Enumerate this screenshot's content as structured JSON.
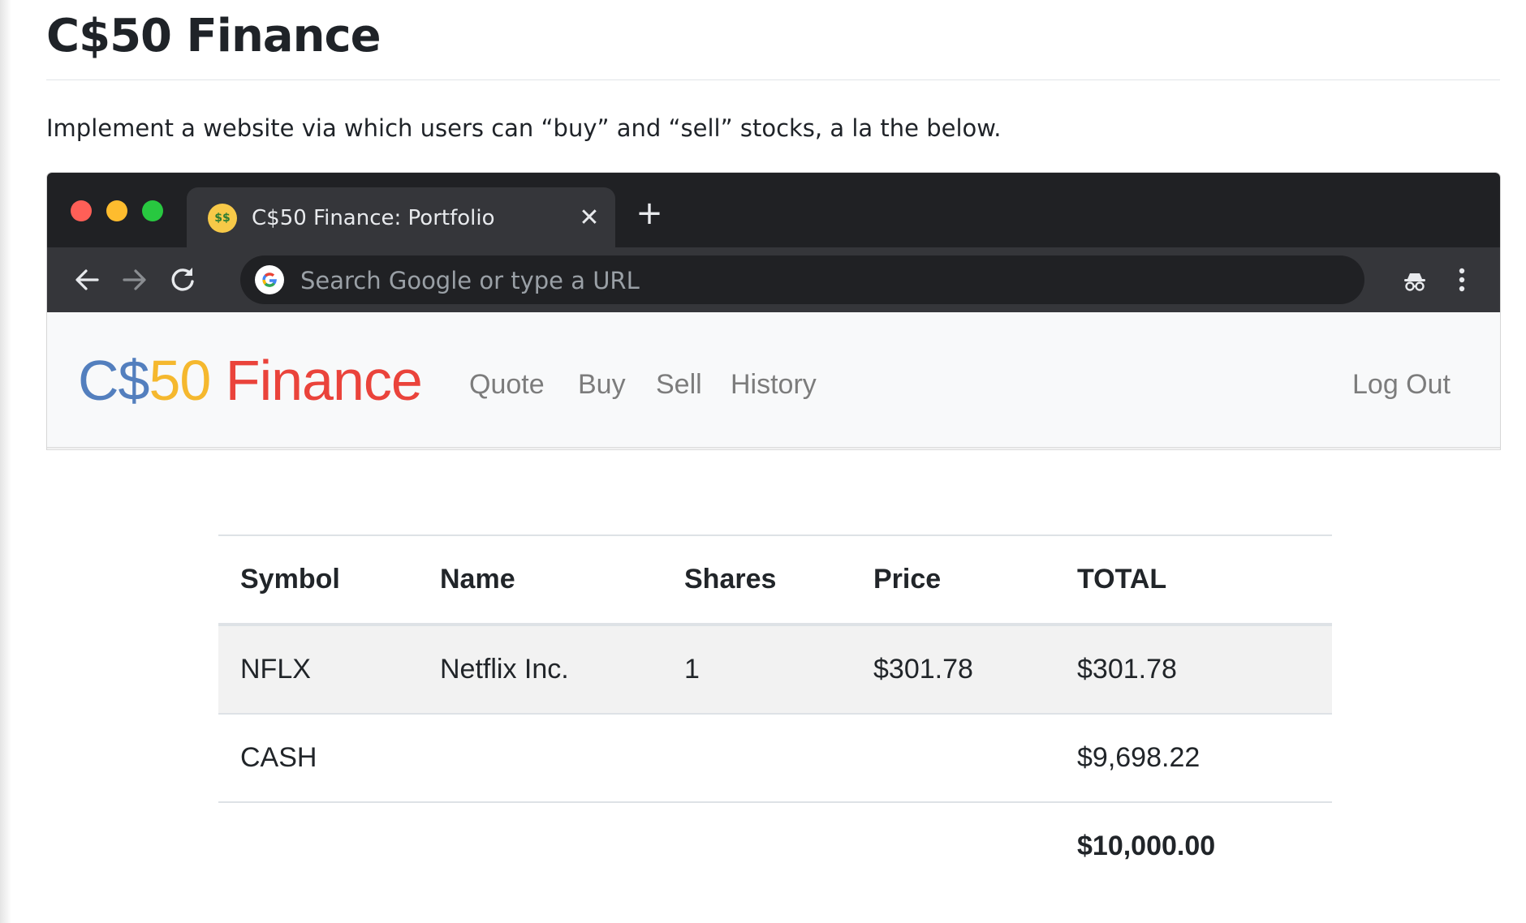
{
  "doc": {
    "title": "C$50 Finance",
    "intro": "Implement a website via which users can “buy” and “sell” stocks, a la the below."
  },
  "browser": {
    "tab": {
      "title": "C$50 Finance: Portfolio",
      "favicon": "money-mouth-face-icon",
      "close": "✕"
    },
    "new_tab": "+",
    "omnibox": {
      "placeholder": "Search Google or type a URL",
      "value": ""
    },
    "icons": [
      "back-arrow-icon",
      "forward-arrow-icon",
      "reload-icon",
      "google-icon",
      "incognito-icon",
      "more-vert-icon"
    ]
  },
  "site": {
    "brand": {
      "part1": "C$",
      "part2": "50",
      "part3": " Finance"
    },
    "nav": [
      "Quote",
      "Buy",
      "Sell",
      "History"
    ],
    "logout": "Log Out",
    "colors": {
      "brand_blue": "#537fbe",
      "brand_red": "#ea433b",
      "brand_yellow": "#f5b82e",
      "brand_green": "#2e944b"
    }
  },
  "table": {
    "headers": [
      "Symbol",
      "Name",
      "Shares",
      "Price",
      "TOTAL"
    ],
    "rows": [
      {
        "symbol": "NFLX",
        "name": "Netflix Inc.",
        "shares": "1",
        "price": "$301.78",
        "total": "$301.78"
      }
    ],
    "cash": {
      "label": "CASH",
      "amount": "$9,698.22"
    },
    "grand_total": "$10,000.00"
  }
}
